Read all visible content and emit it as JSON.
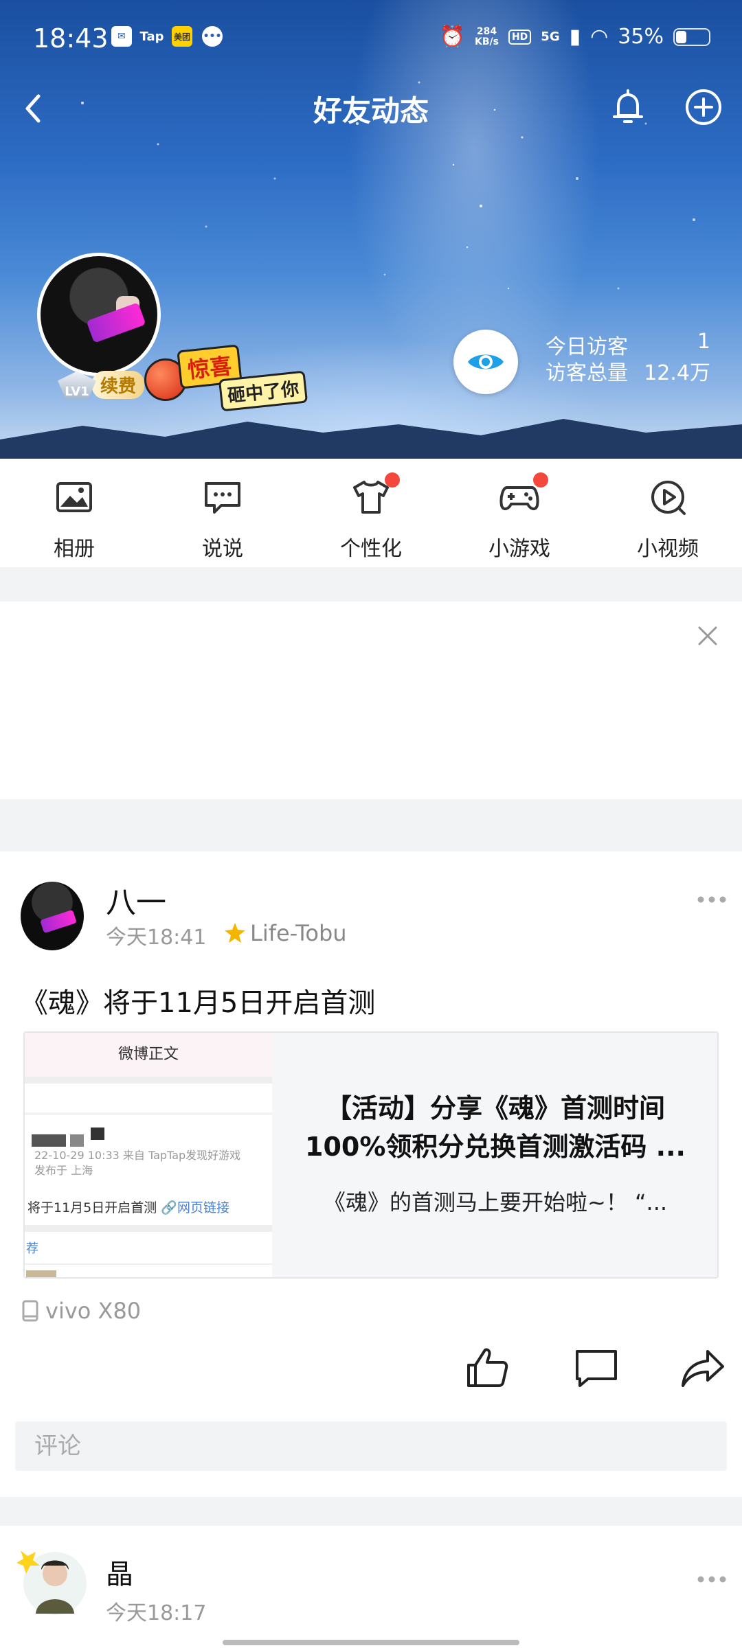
{
  "status_bar": {
    "time": "18:43",
    "app_icons": [
      "mail-icon",
      "Tap",
      "美团",
      "chat-icon"
    ],
    "tap_label": "Tap",
    "meituan_label": "美团",
    "net_speed_value": "284",
    "net_speed_unit": "KB/s",
    "hd_label": "HD",
    "network_label": "5G",
    "battery_percent": "35%"
  },
  "nav": {
    "title": "好友动态"
  },
  "profile": {
    "level_label": "LV1",
    "renew_label": "续费",
    "banner_line1": "惊喜",
    "banner_line2": "砸中了你",
    "visitors_today_label": "今日访客",
    "visitors_today_value": "1",
    "visitors_total_label": "访客总量",
    "visitors_total_value": "12.4万"
  },
  "quick_menu": [
    {
      "label": "相册",
      "icon": "photo-album-icon",
      "badge": false
    },
    {
      "label": "说说",
      "icon": "message-bubble-icon",
      "badge": false
    },
    {
      "label": "个性化",
      "icon": "tshirt-icon",
      "badge": true
    },
    {
      "label": "小游戏",
      "icon": "gamepad-icon",
      "badge": true
    },
    {
      "label": "小视频",
      "icon": "play-video-icon",
      "badge": false
    }
  ],
  "post": {
    "author": "八一",
    "time": "今天18:41",
    "tag": "Life-Tobu",
    "text": "《魂》将于11月5日开启首测",
    "link_card": {
      "thumb_header": "微博正文",
      "thumb_meta_line1": "22-10-29 10:33  来自 TapTap发现好游戏",
      "thumb_meta_line2": "发布于 上海",
      "thumb_line": "将于11月5日开启首测",
      "thumb_link": "网页链接",
      "thumb_recommend": "荐",
      "title": "【活动】分享《魂》首测时间100%领积分兑换首测激活码 ...",
      "description": "《魂》的首测马上要开始啦~！ “..."
    },
    "device": "vivo X80",
    "comment_placeholder": "评论"
  },
  "next_post": {
    "author": "晶",
    "time": "今天18:17"
  },
  "colors": {
    "badge_red": "#f5483d",
    "link_blue": "#4a7fcf",
    "gold_star": "#f2b600"
  }
}
